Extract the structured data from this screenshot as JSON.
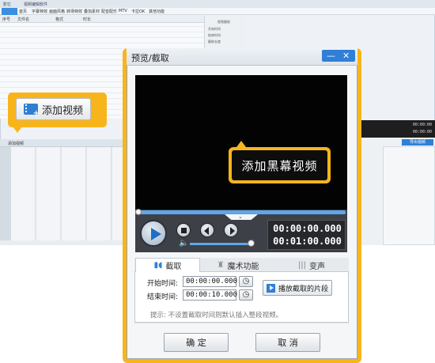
{
  "background_app": {
    "app_name": "影忆",
    "title_text": "视频编辑软件",
    "nav_tabs": [
      "首页",
      "字幕特效",
      "画面风格",
      "转场特效",
      "叠加素材",
      "配音配乐",
      "MTV",
      "卡拉OK",
      "其他功能"
    ],
    "list_columns": [
      "序号",
      "文件名",
      "格式",
      "时长"
    ],
    "panel_title": "视频截取",
    "panel_fields": [
      "开始时间",
      "结束时间",
      "截取长度"
    ],
    "timeline_tab": "添加视频",
    "time_readout_1": "00:00:00",
    "time_readout_2": "00:00:00",
    "export_button": "导出视频"
  },
  "callout_add_video": {
    "label": "添加视频",
    "icon": "film-add-icon"
  },
  "dialog": {
    "title": "预览/截取",
    "minimize": "—",
    "close": "✕",
    "callout_black_video": "添加黑幕视频",
    "time_current": "00:00:00.000",
    "time_total": "00:01:00.000",
    "progress": 0,
    "volume": 0.9,
    "tabs": [
      {
        "label": "截取",
        "icon": "scissors-icon",
        "active": true
      },
      {
        "label": "魔术功能",
        "icon": "magic-hat-icon",
        "active": false
      },
      {
        "label": "变声",
        "icon": "voice-wave-icon",
        "active": false
      }
    ],
    "start_label": "开始时间:",
    "start_value": "00:00:00.000",
    "end_label": "结束时间:",
    "end_value": "00:00:10.000",
    "play_segment": "播放截取的片段",
    "tip": "提示: 不设置截取时间则默认插入整段视频。",
    "ok": "确 定",
    "cancel": "取 消"
  },
  "colors": {
    "accent_orange": "#f8b51b",
    "accent_blue": "#2f7fd8",
    "video_black": "#030303"
  }
}
